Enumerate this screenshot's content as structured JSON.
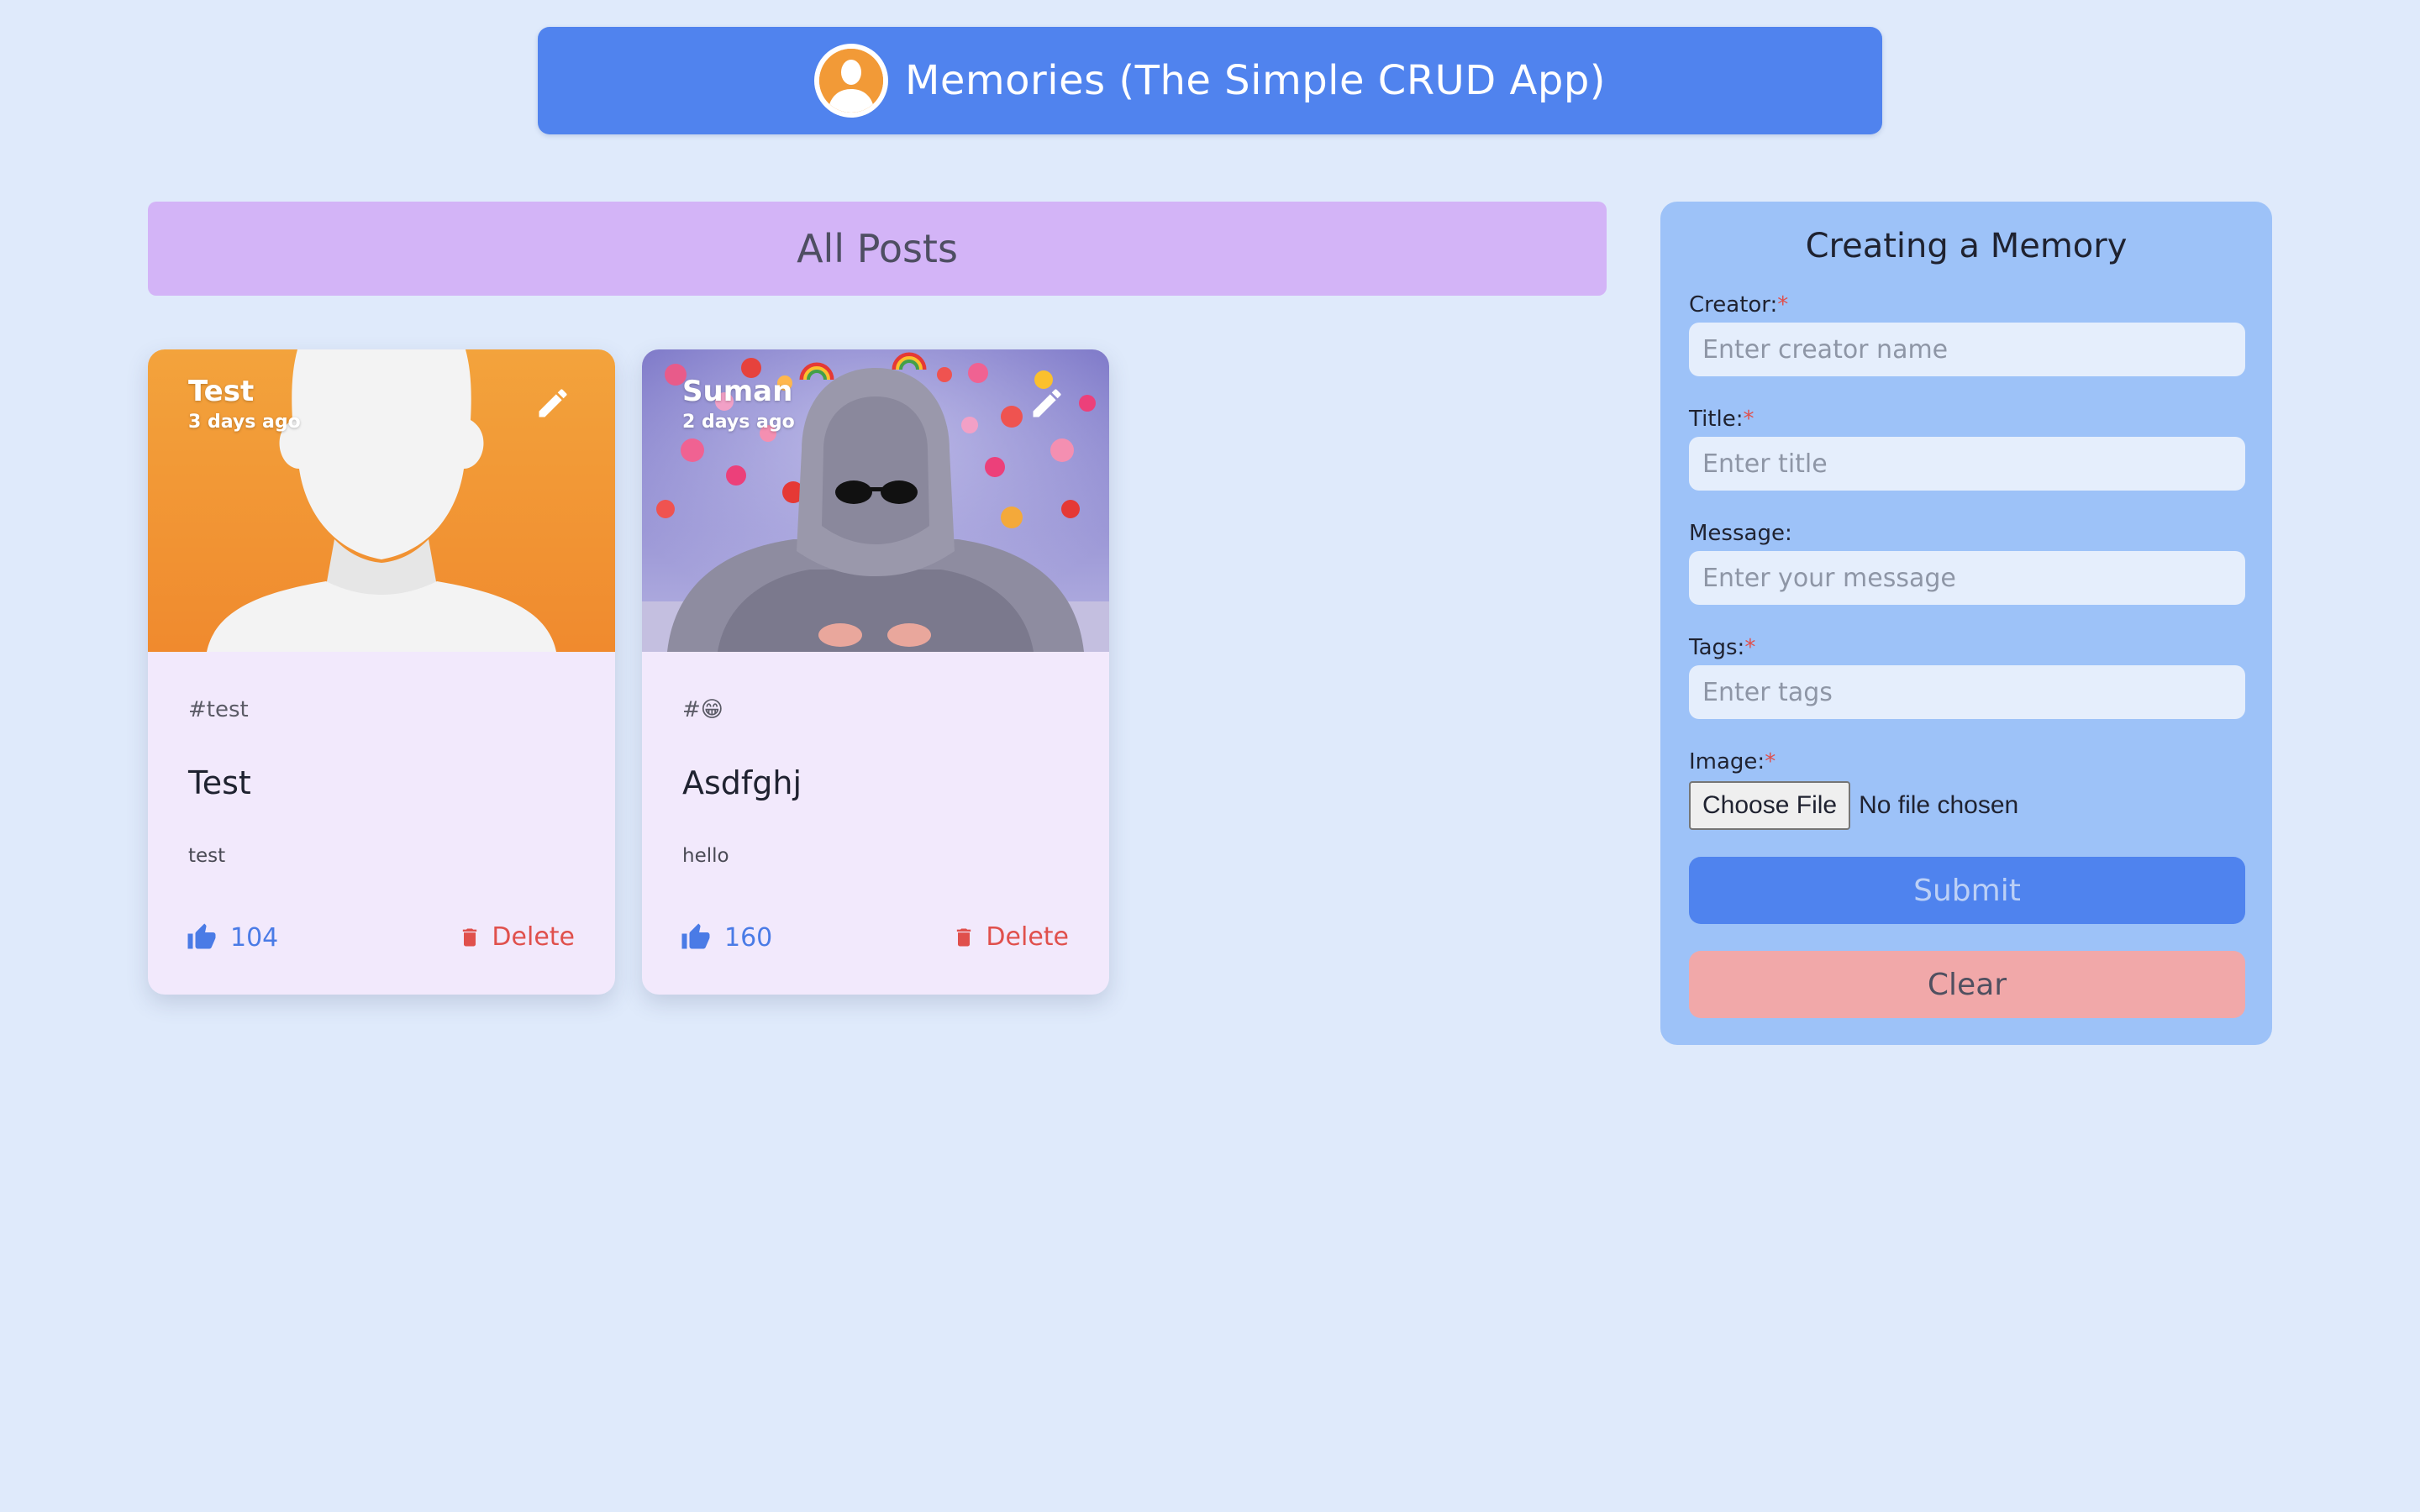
{
  "header": {
    "title": "Memories (The Simple CRUD App)",
    "logo_icon": "user-avatar-icon"
  },
  "posts_section": {
    "title": "All Posts"
  },
  "posts": [
    {
      "creator": "Test",
      "time": "3 days ago",
      "tags": "#test",
      "title": "Test",
      "message": "test",
      "likes": "104",
      "delete_label": "Delete",
      "image": "default-avatar-silhouette"
    },
    {
      "creator": "Suman",
      "time": "2 days ago",
      "tags": "#😁",
      "title": "Asdfghj",
      "message": "hello",
      "likes": "160",
      "delete_label": "Delete",
      "image": "hooded-person-with-hearts-photo"
    }
  ],
  "form": {
    "title": "Creating a Memory",
    "creator_label": "Creator:",
    "creator_placeholder": "Enter creator name",
    "title_label": "Title:",
    "title_placeholder": "Enter title",
    "message_label": "Message:",
    "message_placeholder": "Enter your message",
    "tags_label": "Tags:",
    "tags_placeholder": "Enter tags",
    "image_label": "Image:",
    "file_button_label": "Choose File",
    "file_status": "No file chosen",
    "required_mark": "*",
    "submit_label": "Submit",
    "clear_label": "Clear"
  },
  "colors": {
    "page_bg": "#dfeafb",
    "header_bg": "#5083ee",
    "banner_bg": "#d3b4f7",
    "card_bg": "#f2e9fc",
    "form_bg": "#9dc2f8",
    "like": "#4a7be6",
    "delete": "#e0504c",
    "submit_bg": "#4f83ee",
    "clear_bg": "#f1a8a9"
  }
}
